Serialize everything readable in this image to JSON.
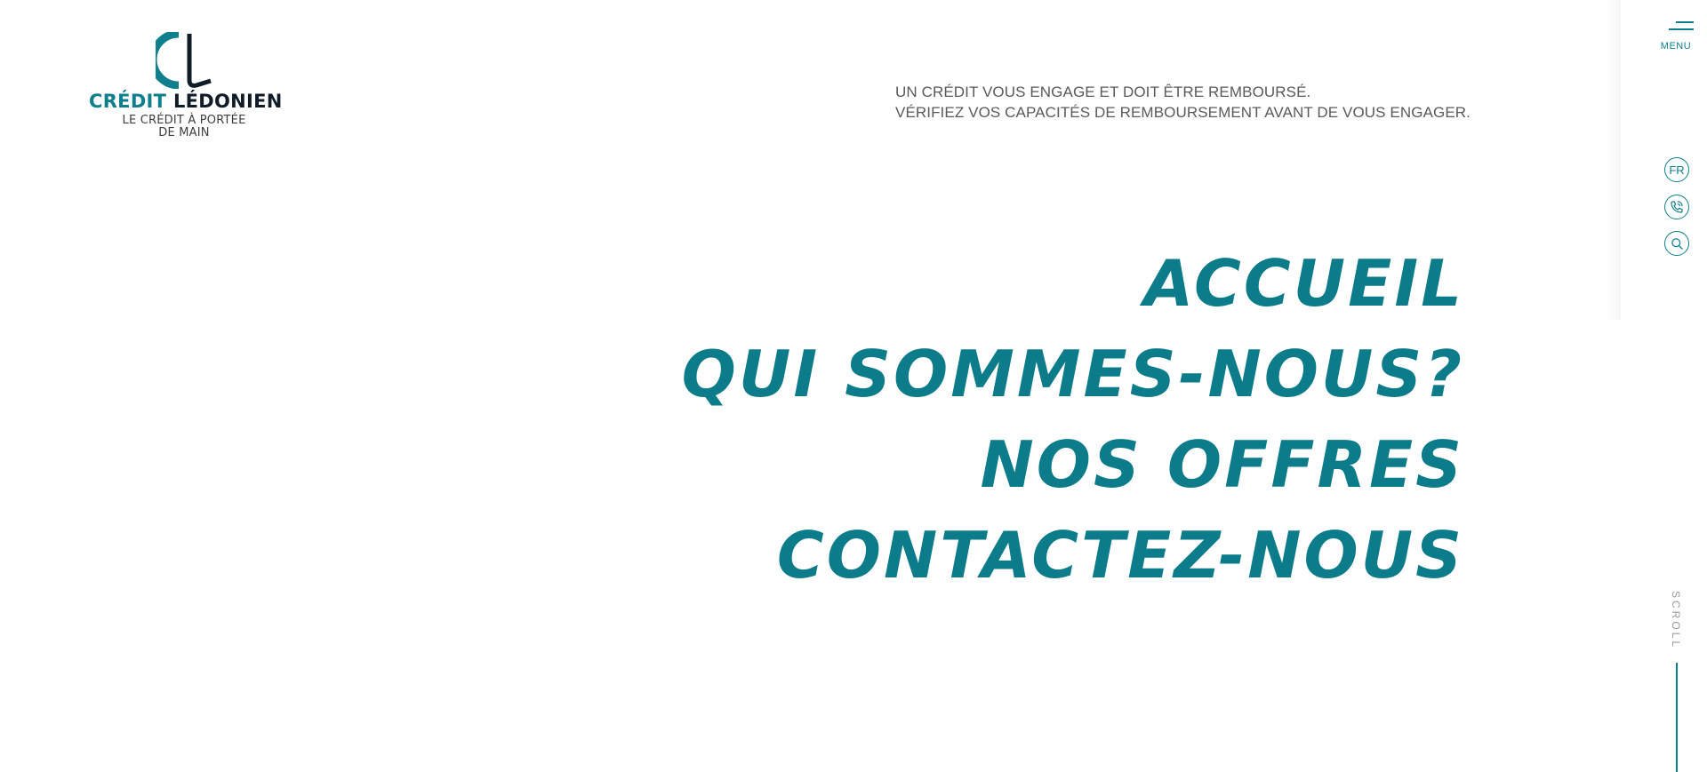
{
  "brand": {
    "name_part1": "CRÉDIT",
    "name_part2": "LÉDONIEN",
    "tagline_line1": "LE CRÉDIT À PORTÉE",
    "tagline_line2": "DE MAIN",
    "colors": {
      "primary": "#0e7f8c",
      "dark": "#111c29"
    }
  },
  "legal": {
    "line1": "UN CRÉDIT VOUS ENGAGE ET DOIT ÊTRE REMBOURSÉ.",
    "line2": "VÉRIFIEZ VOS CAPACITÉS DE REMBOURSEMENT AVANT DE VOUS ENGAGER."
  },
  "nav": {
    "items": [
      {
        "label": "ACCUEIL"
      },
      {
        "label": "QUI SOMMES-NOUS?"
      },
      {
        "label": "NOS OFFRES"
      },
      {
        "label": "CONTACTEZ-NOUS"
      }
    ]
  },
  "rail": {
    "menu_label": "MENU",
    "language": "FR",
    "icons": [
      "hamburger-icon",
      "phone-icon",
      "search-icon"
    ],
    "scroll_label": "SCROLL"
  }
}
